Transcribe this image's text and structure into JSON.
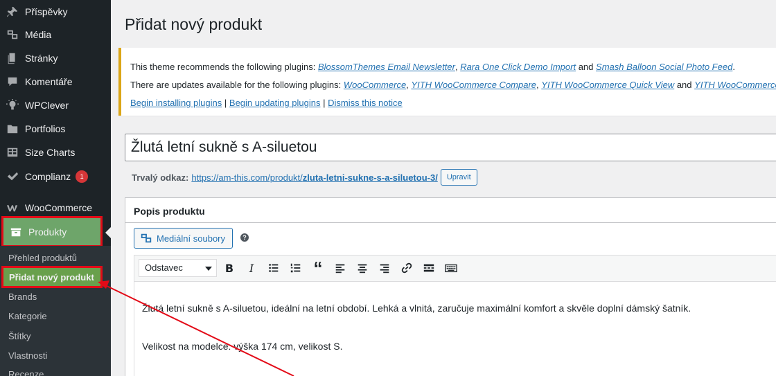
{
  "sidebar": {
    "items": [
      {
        "label": "Příspěvky",
        "icon": "pin-icon"
      },
      {
        "label": "Média",
        "icon": "media-icon"
      },
      {
        "label": "Stránky",
        "icon": "pages-icon"
      },
      {
        "label": "Komentáře",
        "icon": "comments-icon"
      },
      {
        "label": "WPClever",
        "icon": "lightbulb-icon"
      },
      {
        "label": "Portfolios",
        "icon": "folder-icon"
      },
      {
        "label": "Size Charts",
        "icon": "table-icon"
      },
      {
        "label": "Complianz",
        "icon": "checkmark-icon",
        "badge": "1"
      },
      {
        "label": "WooCommerce",
        "icon": "woocommerce-icon"
      },
      {
        "label": "Produkty",
        "icon": "archive-icon"
      }
    ],
    "submenu": [
      "Přehled produktů",
      "Přidat nový produkt",
      "Brands",
      "Kategorie",
      "Štítky",
      "Vlastnosti",
      "Recenze"
    ]
  },
  "page_title": "Přidat nový produkt",
  "notice": {
    "line1_prefix": "This theme recommends the following plugins:",
    "line1_links": [
      "BlossomThemes Email Newsletter",
      "Rara One Click Demo Import",
      "Smash Balloon Social Photo Feed"
    ],
    "line1_sep": ",",
    "line1_and": "and",
    "line1_end": ".",
    "line2_prefix": "There are updates available for the following plugins:",
    "line2_links": [
      "WooCommerce",
      "YITH WooCommerce Compare",
      "YITH WooCommerce Quick View",
      "YITH WooCommerce"
    ],
    "line2_and": "and",
    "actions": [
      "Begin installing plugins",
      "Begin updating plugins",
      "Dismiss this notice"
    ],
    "action_sep": "|"
  },
  "product_title": "Žlutá letní sukně s A-siluetou",
  "permalink": {
    "label": "Trvalý odkaz:",
    "base": "https://am-this.com/produkt/",
    "slug": "zluta-letni-sukne-s-a-siluetou-3/",
    "edit_button": "Upravit"
  },
  "description_box": {
    "title": "Popis produktu",
    "media_button": "Mediální soubory",
    "help": "?",
    "format_select": "Odstavec",
    "toolbar": [
      "bold-icon",
      "italic-icon",
      "bullet-list-icon",
      "numbered-list-icon",
      "blockquote-icon",
      "align-left-icon",
      "align-center-icon",
      "align-right-icon",
      "link-icon",
      "read-more-icon",
      "toolbar-toggle-icon"
    ],
    "bold_glyph": "B",
    "italic_glyph": "I",
    "quote_glyph": "“",
    "content": [
      "Žlutá letní sukně s A-siluetou, ideální na letní období. Lehká a vlnitá, zaručuje maximální komfort a skvěle doplní dámský šatník.",
      "Velikost na modelce: výška 174 cm, velikost S."
    ]
  },
  "colors": {
    "sidebar_bg": "#1d2327",
    "highlight_green": "#6ea56a",
    "annotation_red": "#e30a17",
    "link_blue": "#2271b1",
    "notice_border": "#dba617"
  }
}
